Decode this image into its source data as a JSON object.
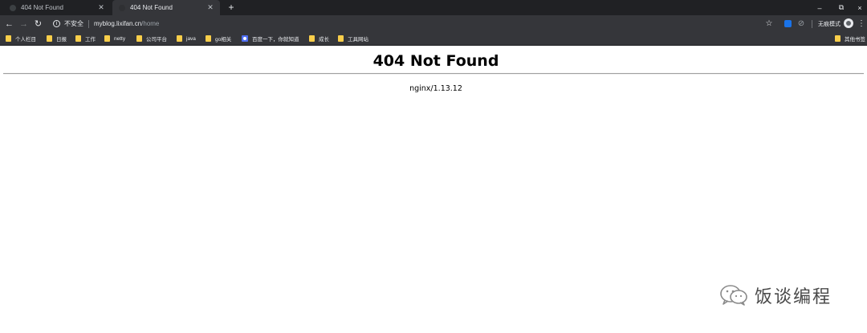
{
  "browser": {
    "tabs": [
      {
        "title": "404 Not Found",
        "active": false
      },
      {
        "title": "404 Not Found",
        "active": true
      }
    ],
    "new_tab_label": "+",
    "window_controls": {
      "minimize": "–",
      "restore": "⧉",
      "close": "×"
    },
    "toolbar": {
      "security_label": "不安全",
      "url_host": "myblog.lixifan.cn",
      "url_path": "/home",
      "incognito_label": "无痕模式"
    },
    "bookmarks": [
      {
        "label": "个人栏目",
        "icon": "folder-icon"
      },
      {
        "label": "日报",
        "icon": "folder-icon"
      },
      {
        "label": "工作",
        "icon": "folder-icon"
      },
      {
        "label": "netty",
        "icon": "folder-icon"
      },
      {
        "label": "公司平台",
        "icon": "folder-icon"
      },
      {
        "label": "java",
        "icon": "folder-icon"
      },
      {
        "label": "go相关",
        "icon": "folder-icon"
      },
      {
        "label": "百度一下，你就知道",
        "icon": "baidu-icon"
      },
      {
        "label": "成长",
        "icon": "folder-icon"
      },
      {
        "label": "工具网站",
        "icon": "folder-icon"
      }
    ],
    "other_bookmarks_label": "其他书签"
  },
  "page": {
    "heading": "404 Not Found",
    "server": "nginx/1.13.12"
  },
  "watermark": {
    "text": "饭谈编程"
  },
  "colors": {
    "tabstrip": "#202124",
    "toolbar": "#35363a",
    "folder": "#f9ce4a",
    "accent": "#1a73e8"
  }
}
